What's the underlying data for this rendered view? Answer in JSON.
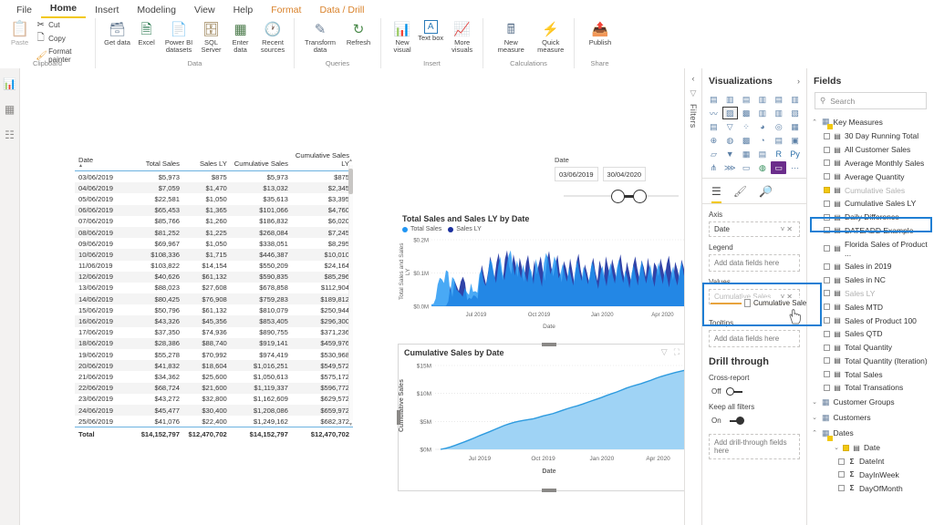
{
  "ribbon": {
    "tabs": [
      {
        "label": "File",
        "state": "normal"
      },
      {
        "label": "Home",
        "state": "active"
      },
      {
        "label": "Insert",
        "state": "normal"
      },
      {
        "label": "Modeling",
        "state": "normal"
      },
      {
        "label": "View",
        "state": "normal"
      },
      {
        "label": "Help",
        "state": "normal"
      },
      {
        "label": "Format",
        "state": "context"
      },
      {
        "label": "Data / Drill",
        "state": "context"
      }
    ],
    "groups": [
      {
        "label": "Clipboard",
        "paste": "Paste",
        "items": [
          "Cut",
          "Copy",
          "Format painter"
        ]
      },
      {
        "label": "Data",
        "items": [
          "Get data",
          "Excel",
          "Power BI datasets",
          "SQL Server",
          "Enter data",
          "Recent sources"
        ]
      },
      {
        "label": "Queries",
        "items": [
          "Transform data",
          "Refresh"
        ]
      },
      {
        "label": "Insert",
        "items": [
          "New visual",
          "Text box",
          "More visuals"
        ]
      },
      {
        "label": "Calculations",
        "items": [
          "New measure",
          "Quick measure"
        ]
      },
      {
        "label": "Share",
        "items": [
          "Publish"
        ]
      }
    ]
  },
  "leftnav": {
    "items": [
      "report-view",
      "data-view",
      "model-view"
    ]
  },
  "slicer": {
    "label": "Date",
    "start": "03/06/2019",
    "end": "30/04/2020"
  },
  "table": {
    "columns": [
      "Date",
      "Total Sales",
      "Sales LY",
      "Cumulative Sales",
      "Cumulative Sales LY"
    ],
    "rows": [
      [
        "03/06/2019",
        "$5,973",
        "$875",
        "$5,973",
        "$875"
      ],
      [
        "04/06/2019",
        "$7,059",
        "$1,470",
        "$13,032",
        "$2,345"
      ],
      [
        "05/06/2019",
        "$22,581",
        "$1,050",
        "$35,613",
        "$3,395"
      ],
      [
        "06/06/2019",
        "$65,453",
        "$1,365",
        "$101,066",
        "$4,760"
      ],
      [
        "07/06/2019",
        "$85,766",
        "$1,260",
        "$186,832",
        "$6,020"
      ],
      [
        "08/06/2019",
        "$81,252",
        "$1,225",
        "$268,084",
        "$7,245"
      ],
      [
        "09/06/2019",
        "$69,967",
        "$1,050",
        "$338,051",
        "$8,295"
      ],
      [
        "10/06/2019",
        "$108,336",
        "$1,715",
        "$446,387",
        "$10,010"
      ],
      [
        "11/06/2019",
        "$103,822",
        "$14,154",
        "$550,209",
        "$24,164"
      ],
      [
        "12/06/2019",
        "$40,626",
        "$61,132",
        "$590,835",
        "$85,296"
      ],
      [
        "13/06/2019",
        "$88,023",
        "$27,608",
        "$678,858",
        "$112,904"
      ],
      [
        "14/06/2019",
        "$80,425",
        "$76,908",
        "$759,283",
        "$189,812"
      ],
      [
        "15/06/2019",
        "$50,796",
        "$61,132",
        "$810,079",
        "$250,944"
      ],
      [
        "16/06/2019",
        "$43,326",
        "$45,356",
        "$853,405",
        "$296,300"
      ],
      [
        "17/06/2019",
        "$37,350",
        "$74,936",
        "$890,755",
        "$371,236"
      ],
      [
        "18/06/2019",
        "$28,386",
        "$88,740",
        "$919,141",
        "$459,976"
      ],
      [
        "19/06/2019",
        "$55,278",
        "$70,992",
        "$974,419",
        "$530,968"
      ],
      [
        "20/06/2019",
        "$41,832",
        "$18,604",
        "$1,016,251",
        "$549,572"
      ],
      [
        "21/06/2019",
        "$34,362",
        "$25,600",
        "$1,050,613",
        "$575,172"
      ],
      [
        "22/06/2019",
        "$68,724",
        "$21,600",
        "$1,119,337",
        "$596,772"
      ],
      [
        "23/06/2019",
        "$43,272",
        "$32,800",
        "$1,162,609",
        "$629,572"
      ],
      [
        "24/06/2019",
        "$45,477",
        "$30,400",
        "$1,208,086",
        "$659,972"
      ],
      [
        "25/06/2019",
        "$41,076",
        "$22,400",
        "$1,249,162",
        "$682,372"
      ]
    ],
    "total": [
      "Total",
      "$14,152,797",
      "$12,470,702",
      "$14,152,797",
      "$12,470,702"
    ]
  },
  "chart_data": [
    {
      "type": "area",
      "title": "Total Sales and Sales LY by Date",
      "xlabel": "Date",
      "ylabel": "Total Sales and Sales LY",
      "legend": [
        "Total Sales",
        "Sales LY"
      ],
      "legend_position": "top",
      "colors": [
        "#2196f3",
        "#1a2f9e"
      ],
      "yticks": [
        "$0.0M",
        "$0.1M",
        "$0.2M"
      ],
      "ylim": [
        0,
        200000
      ],
      "xticks": [
        "Jul 2019",
        "Oct 2019",
        "Jan 2020",
        "Apr 2020"
      ],
      "grid": true,
      "series": [
        {
          "name": "Total Sales",
          "values": [
            5973,
            7059,
            22581,
            65453,
            85766,
            81252,
            69967,
            108336,
            103822,
            40626,
            88023,
            80425,
            50796,
            43326,
            37350,
            28386,
            55278,
            41832,
            34362,
            68724,
            43272,
            45477,
            41076,
            96000,
            112000,
            75000,
            61000,
            88000,
            140000,
            132000,
            96000,
            70000,
            118000,
            149000,
            103000,
            78000,
            120000,
            152000,
            168000,
            125000,
            92000,
            138000,
            110000,
            84000,
            126000,
            95000,
            72000,
            118000,
            104000,
            66000,
            142000,
            118000,
            88000,
            59000,
            130000,
            160000,
            142000,
            96000,
            116000,
            150000,
            132000,
            84000,
            100000,
            128000,
            96000,
            74000,
            118000,
            90000,
            62000,
            108000,
            140000,
            102000,
            76000,
            120000,
            96000,
            66000,
            92000,
            134000,
            116000,
            80000,
            52000,
            96000,
            122000,
            88000,
            60000,
            104000,
            130000,
            92000,
            68000,
            115000,
            142000,
            98000,
            70000,
            108000,
            86000,
            54000,
            98000,
            124000,
            90000,
            62000,
            110000,
            138000,
            96000,
            68000,
            100000,
            126000,
            86000,
            58000,
            104000,
            132000,
            94000,
            66000,
            112000,
            88000,
            56000,
            98000,
            120000,
            84000,
            62000,
            106000,
            134000,
            96000,
            70000,
            116000,
            90000,
            60000,
            102000
          ]
        },
        {
          "name": "Sales LY",
          "values": [
            875,
            1470,
            1050,
            1365,
            1260,
            1225,
            1050,
            1715,
            14154,
            61132,
            27608,
            76908,
            61132,
            45356,
            74936,
            88740,
            70992,
            18604,
            25600,
            21600,
            32800,
            30400,
            22400,
            86000,
            124000,
            92000,
            66000,
            104000,
            150000,
            118000,
            84000,
            132000,
            160000,
            110000,
            78000,
            142000,
            168000,
            120000,
            96000,
            156000,
            128000,
            88000,
            146000,
            118000,
            74000,
            130000,
            154000,
            106000,
            82000,
            138000,
            96000,
            124000,
            150000,
            108000,
            76000,
            140000,
            166000,
            118000,
            90000,
            128000,
            154000,
            102000,
            72000,
            136000,
            116000,
            86000,
            144000,
            108000,
            68000,
            132000,
            158000,
            110000,
            80000,
            126000,
            102000,
            72000,
            118000,
            146000,
            104000,
            76000,
            138000,
            112000,
            82000,
            150000,
            120000,
            90000,
            142000,
            114000,
            84000,
            128000,
            156000,
            108000,
            78000,
            134000,
            106000,
            74000,
            124000,
            150000,
            112000,
            82000,
            138000,
            118000,
            88000,
            146000,
            108000,
            76000,
            132000,
            120000,
            90000,
            144000,
            116000,
            86000,
            128000,
            152000,
            106000,
            78000,
            134000,
            112000,
            84000,
            140000,
            118000,
            88000,
            126000,
            150000,
            108000,
            80000
          ]
        }
      ]
    },
    {
      "type": "area",
      "title": "Cumulative Sales by Date",
      "xlabel": "Date",
      "ylabel": "Cumulative Sales",
      "colors": [
        "#2e9bdf"
      ],
      "fill": "#9fd3f5",
      "yticks": [
        "$0M",
        "$5M",
        "$10M",
        "$15M"
      ],
      "ylim": [
        0,
        15000000
      ],
      "xticks": [
        "Jul 2019",
        "Oct 2019",
        "Jan 2020",
        "Apr 2020"
      ],
      "grid": true,
      "series": [
        {
          "name": "Cumulative Sales",
          "values": [
            0,
            180000,
            420000,
            720000,
            1050000,
            1380000,
            1720000,
            2080000,
            2460000,
            2800000,
            3150000,
            3520000,
            3900000,
            4260000,
            4560000,
            4820000,
            5020000,
            5180000,
            5320000,
            5480000,
            5720000,
            5980000,
            6180000,
            6400000,
            6700000,
            7000000,
            7300000,
            7560000,
            7800000,
            8080000,
            8400000,
            8700000,
            9000000,
            9300000,
            9650000,
            9950000,
            10250000,
            10600000,
            10950000,
            11250000,
            11500000,
            11750000,
            12050000,
            12350000,
            12700000,
            13000000,
            13250000,
            13500000,
            13750000,
            13950000,
            14152797
          ]
        }
      ]
    }
  ],
  "vis_header_icons": [
    "filter-icon",
    "focus-mode-icon",
    "more-options-icon"
  ],
  "visualizations": {
    "title": "Visualizations",
    "grid_icons": [
      "stacked-bar-chart",
      "stacked-column-chart",
      "clustered-bar-chart",
      "clustered-column-chart",
      "100-stacked-bar-chart",
      "100-stacked-column-chart",
      "line-chart",
      "area-chart",
      "stacked-area-chart",
      "line-and-stacked-column-chart",
      "line-and-clustered-column-chart",
      "ribbon-chart",
      "waterfall-chart",
      "funnel-chart",
      "scatter-chart",
      "pie-chart",
      "donut-chart",
      "treemap",
      "map",
      "filled-map",
      "shape-map",
      "gauge",
      "multi-row-card",
      "card",
      "kpi",
      "slicer",
      "table",
      "matrix",
      "r-script-visual",
      "python-visual",
      "decomposition-tree",
      "key-influencers",
      "q-and-a",
      "arcgis-map",
      "paginated-report",
      "more-visuals"
    ],
    "selected_icon_index": 7,
    "purple_icon_index": 34,
    "well_tabs": [
      "fields-tab",
      "format-tab",
      "analytics-tab"
    ],
    "wells": {
      "axis_label": "Axis",
      "axis_value": "Date",
      "legend_label": "Legend",
      "legend_placeholder": "Add data fields here",
      "values_label": "Values",
      "values_chip": "Cumulative Sales",
      "drag_ghost": "Cumulative Sales LY",
      "tooltips_label": "Tooltips",
      "tooltips_placeholder": "Add data fields here"
    },
    "drill": {
      "title": "Drill through",
      "cross_report_label": "Cross-report",
      "cross_report_state": "Off",
      "keep_filters_label": "Keep all filters",
      "keep_filters_state": "On",
      "placeholder": "Add drill-through fields here"
    }
  },
  "filters": {
    "label": "Filters"
  },
  "fields": {
    "title": "Fields",
    "search_placeholder": "Search",
    "groups": [
      {
        "name": "Key Measures",
        "type": "measure-table",
        "expanded": true,
        "items": [
          {
            "label": "30 Day Running Total",
            "kind": "measure"
          },
          {
            "label": "All Customer Sales",
            "kind": "measure"
          },
          {
            "label": "Average Monthly Sales",
            "kind": "measure"
          },
          {
            "label": "Average Quantity",
            "kind": "measure"
          },
          {
            "label": "Cumulative Sales",
            "kind": "measure",
            "checked": true
          },
          {
            "label": "Cumulative Sales LY",
            "kind": "measure",
            "highlighted": true
          },
          {
            "label": "Daily Difference",
            "kind": "measure"
          },
          {
            "label": "DATEADD Example",
            "kind": "measure"
          },
          {
            "label": "Florida Sales of Product ...",
            "kind": "measure"
          },
          {
            "label": "Sales in 2019",
            "kind": "measure"
          },
          {
            "label": "Sales in NC",
            "kind": "measure"
          },
          {
            "label": "Sales LY",
            "kind": "measure"
          },
          {
            "label": "Sales MTD",
            "kind": "measure"
          },
          {
            "label": "Sales of Product 100",
            "kind": "measure"
          },
          {
            "label": "Sales QTD",
            "kind": "measure"
          },
          {
            "label": "Total Quantity",
            "kind": "measure"
          },
          {
            "label": "Total Quantity (Iteration)",
            "kind": "measure"
          },
          {
            "label": "Total Sales",
            "kind": "measure"
          },
          {
            "label": "Total Transations",
            "kind": "measure"
          }
        ]
      },
      {
        "name": "Customer Groups",
        "type": "table",
        "expanded": false,
        "items": []
      },
      {
        "name": "Customers",
        "type": "table",
        "expanded": false,
        "items": []
      },
      {
        "name": "Dates",
        "type": "table",
        "expanded": true,
        "items": [
          {
            "label": "Date",
            "kind": "date-hierarchy",
            "checked": true,
            "level": 1
          },
          {
            "label": "DateInt",
            "kind": "numeric",
            "level": 2
          },
          {
            "label": "DayInWeek",
            "kind": "numeric",
            "level": 2
          },
          {
            "label": "DayOfMonth",
            "kind": "numeric",
            "level": 2
          }
        ]
      }
    ]
  },
  "annotations": {
    "field_highlight": "Cumulative Sales LY",
    "well_highlight": "Values"
  }
}
